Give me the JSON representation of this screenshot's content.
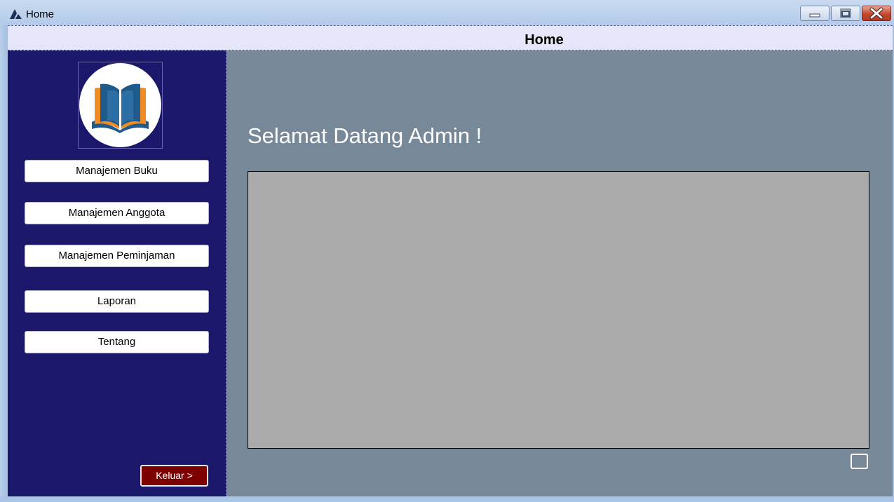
{
  "window": {
    "title": "Home",
    "controls": [
      "minimize-icon",
      "maximize-icon",
      "close-icon"
    ]
  },
  "header": {
    "title": "Home"
  },
  "sidebar": {
    "logo": "open-book-logo",
    "items": [
      {
        "label": "Manajemen Buku"
      },
      {
        "label": "Manajemen Anggota"
      },
      {
        "label": "Manajemen Peminjaman"
      },
      {
        "label": "Laporan"
      },
      {
        "label": "Tentang"
      }
    ],
    "logout_label": "Keluar >"
  },
  "main": {
    "welcome": "Selamat Datang Admin !"
  },
  "colors": {
    "sidebar_bg": "#1b186b",
    "main_bg": "#778899",
    "header_bg": "#e6e6fa",
    "panel_bg": "#aaaaaa",
    "logout_bg": "#7d0000",
    "logo_blue": "#1f5a8a",
    "logo_orange": "#f08a24"
  }
}
